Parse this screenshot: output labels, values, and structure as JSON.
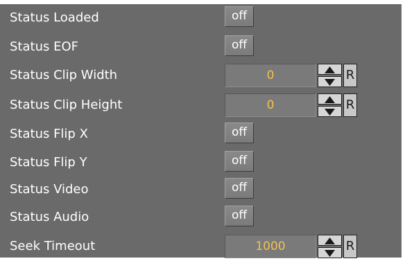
{
  "properties": [
    {
      "label": "Status Loaded",
      "value": "off"
    },
    {
      "label": "Status EOF",
      "value": "off"
    },
    {
      "label": "Status Clip Width",
      "value": "0",
      "reset_label": "R"
    },
    {
      "label": "Status Clip Height",
      "value": "0",
      "reset_label": "R"
    },
    {
      "label": "Status Flip X",
      "value": "off"
    },
    {
      "label": "Status Flip Y",
      "value": "off"
    },
    {
      "label": "Status Video",
      "value": "off"
    },
    {
      "label": "Status Audio",
      "value": "off"
    },
    {
      "label": "Seek Timeout",
      "value": "1000",
      "reset_label": "R"
    }
  ],
  "colors": {
    "panel_background": "#6a6a6a",
    "number_text": "#f2c152",
    "label_text": "#ffffff"
  }
}
